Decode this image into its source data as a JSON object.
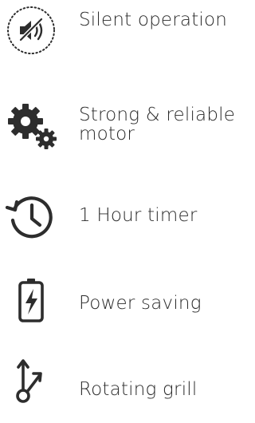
{
  "features": [
    {
      "label": "Silent operation",
      "icon": "silent-icon"
    },
    {
      "label": "Strong & reliable motor",
      "icon": "gears-icon"
    },
    {
      "label": "1 Hour timer",
      "icon": "timer-icon"
    },
    {
      "label": "Power saving",
      "icon": "battery-icon"
    },
    {
      "label": "Rotating grill",
      "icon": "rotating-grill-icon"
    }
  ],
  "colors": {
    "icon": "#2d2d2d",
    "text": "#2b2b2b"
  }
}
